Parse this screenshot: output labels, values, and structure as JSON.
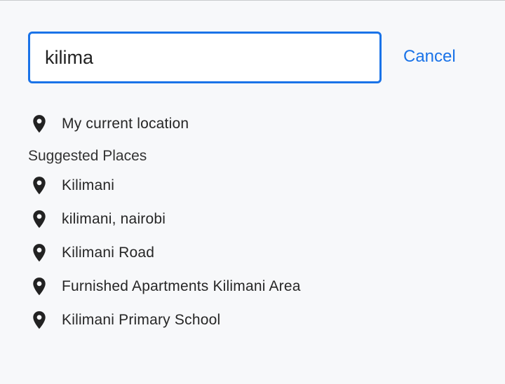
{
  "search": {
    "value": "kilima",
    "cancel_label": "Cancel"
  },
  "current_location": {
    "label": "My current location",
    "icon": "map-pin-icon"
  },
  "suggested": {
    "heading": "Suggested Places",
    "items": [
      {
        "label": "Kilimani",
        "icon": "map-pin-icon"
      },
      {
        "label": "kilimani, nairobi",
        "icon": "map-pin-icon"
      },
      {
        "label": "Kilimani Road",
        "icon": "map-pin-icon"
      },
      {
        "label": "Furnished Apartments Kilimani Area",
        "icon": "map-pin-icon"
      },
      {
        "label": "Kilimani Primary School",
        "icon": "map-pin-icon"
      }
    ]
  },
  "colors": {
    "accent": "#1a73e8",
    "background": "#f7f8fa",
    "text": "#262626"
  }
}
